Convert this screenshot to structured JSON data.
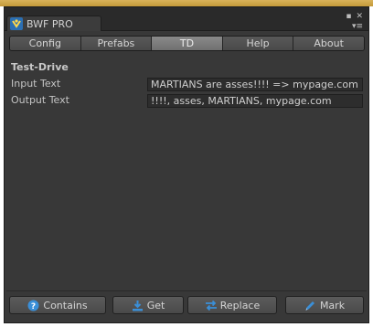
{
  "window": {
    "tab_title": "BWF PRO",
    "controls": [
      "restore-icon",
      "close-icon",
      "menu-icon"
    ]
  },
  "tabs": [
    {
      "label": "Config",
      "active": false
    },
    {
      "label": "Prefabs",
      "active": false
    },
    {
      "label": "TD",
      "active": true
    },
    {
      "label": "Help",
      "active": false
    },
    {
      "label": "About",
      "active": false
    }
  ],
  "section": {
    "title": "Test-Drive",
    "input_label": "Input Text",
    "input_value": "MARTIANS are asses!!!! => mypage.com",
    "output_label": "Output Text",
    "output_value": "!!!!, asses, MARTIANS, mypage.com"
  },
  "buttons": {
    "contains": "Contains",
    "get": "Get",
    "replace": "Replace",
    "mark": "Mark"
  },
  "colors": {
    "accent_blue": "#3a8fd8",
    "panel": "#383838",
    "titlebar_gold": "#c49a3a"
  }
}
